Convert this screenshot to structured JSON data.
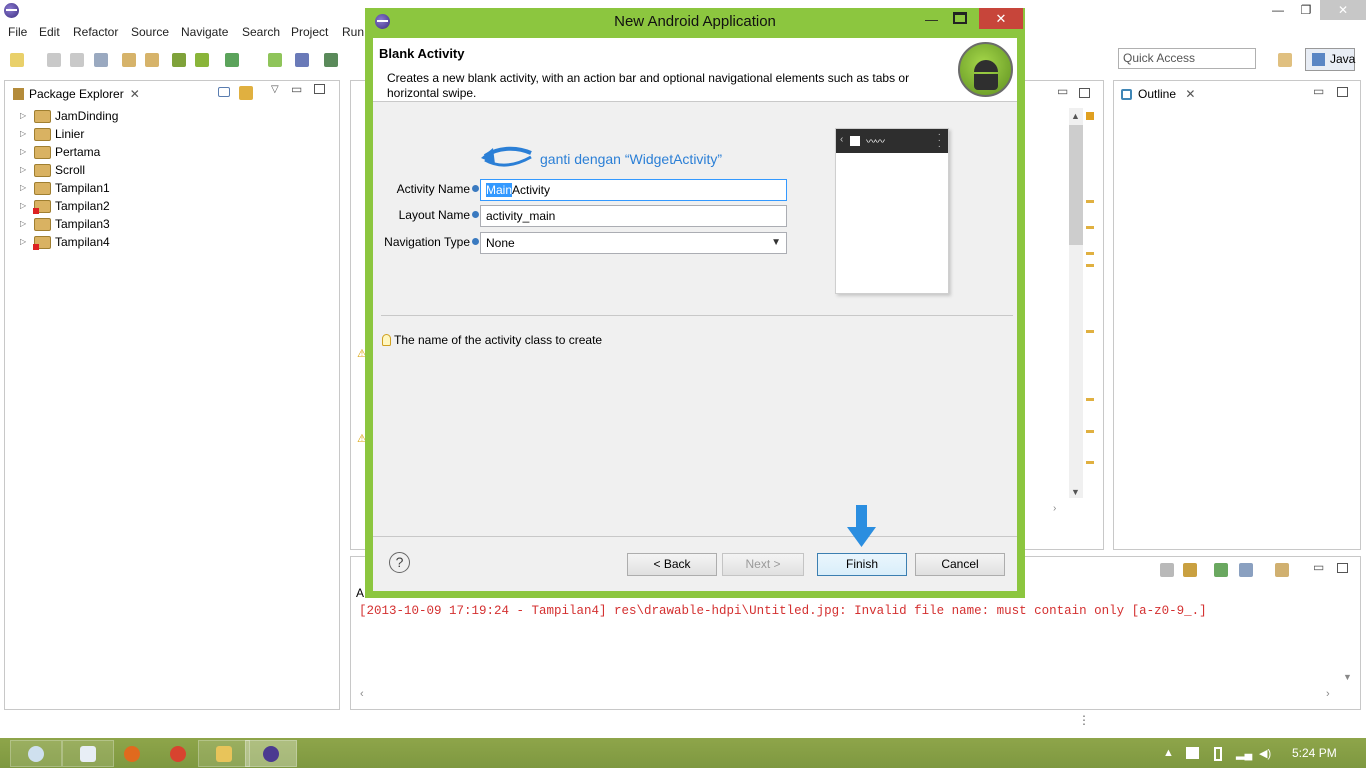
{
  "menubar": [
    "File",
    "Edit",
    "Refactor",
    "Source",
    "Navigate",
    "Search",
    "Project",
    "Run"
  ],
  "toolbar": {
    "quick_access_placeholder": "Quick Access",
    "perspective_label": "Java"
  },
  "package_explorer": {
    "tab_label": "Package Explorer",
    "close_glyph": "✕",
    "projects": [
      {
        "name": "JamDinding",
        "error": false
      },
      {
        "name": "Linier",
        "error": false
      },
      {
        "name": "Pertama",
        "error": false
      },
      {
        "name": "Scroll",
        "error": false
      },
      {
        "name": "Tampilan1",
        "error": false
      },
      {
        "name": "Tampilan2",
        "error": true
      },
      {
        "name": "Tampilan3",
        "error": false
      },
      {
        "name": "Tampilan4",
        "error": true
      }
    ]
  },
  "outline": {
    "tab_label": "Outline",
    "close_glyph": "✕"
  },
  "console": {
    "message": "[2013-10-09 17:19:24 - Tampilan4] res\\drawable-hdpi\\Untitled.jpg: Invalid file name: must contain only [a-z0-9_.]"
  },
  "dialog": {
    "title": "New Android Application",
    "header_title": "Blank Activity",
    "header_description": "Creates a new blank activity, with an action bar and optional navigational elements such as tabs or horizontal swipe.",
    "annotation": "ganti dengan “WidgetActivity”",
    "fields": {
      "activity_name_label": "Activity Name",
      "activity_name_selected": "Main",
      "activity_name_rest": "Activity",
      "layout_name_label": "Layout Name",
      "layout_name_value": "activity_main",
      "navigation_type_label": "Navigation Type",
      "navigation_type_value": "None"
    },
    "hint": "The name of the activity class to create",
    "buttons": {
      "back": "< Back",
      "next": "Next >",
      "finish": "Finish",
      "cancel": "Cancel",
      "help": "?"
    }
  },
  "taskbar": {
    "clock": "5:24 PM"
  }
}
